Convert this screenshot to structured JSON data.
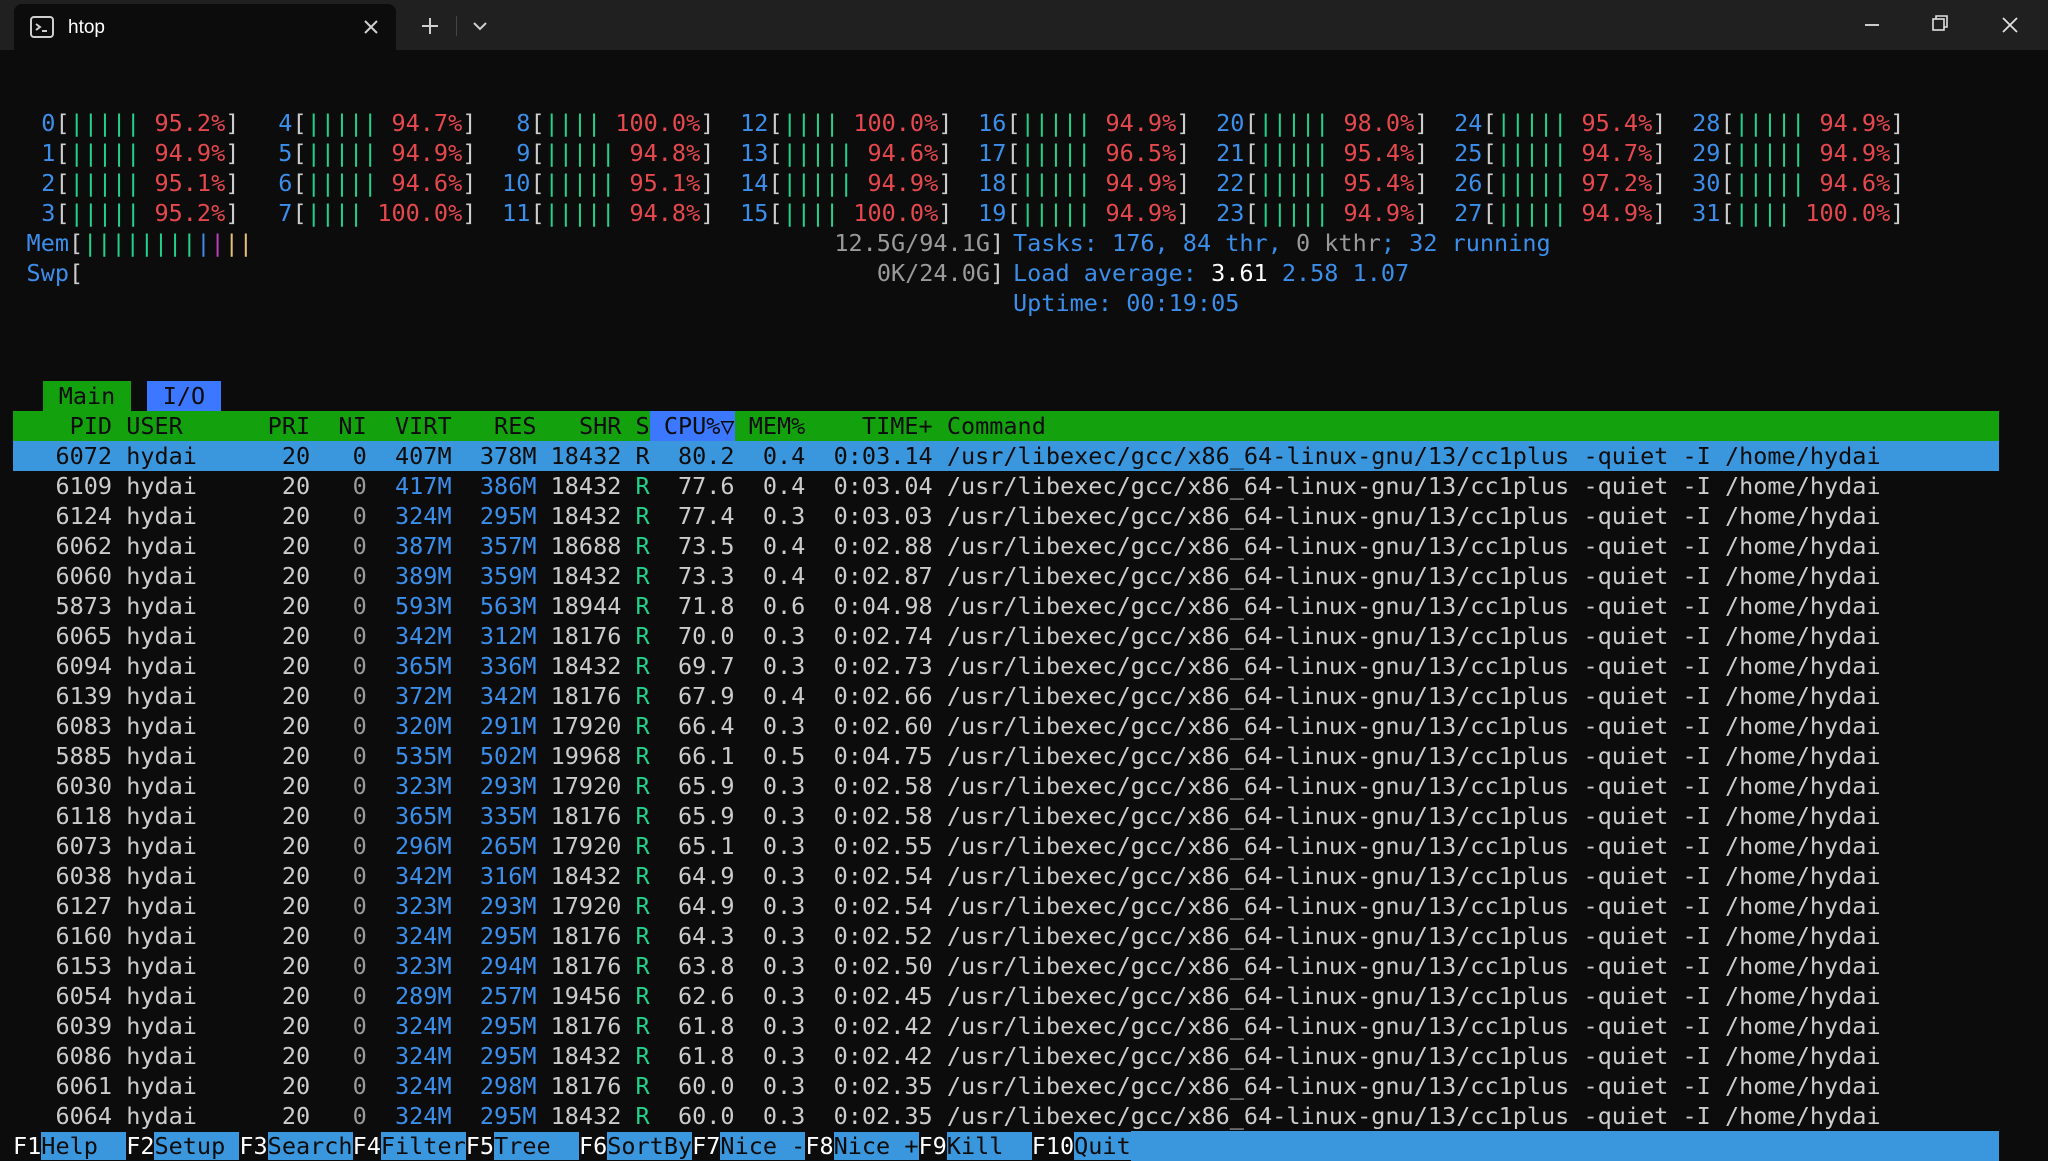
{
  "window": {
    "tab_title": "htop",
    "icons": {
      "tab": "terminal-icon",
      "close": "close-icon",
      "new_tab": "plus-icon",
      "dropdown": "chevron-down-icon",
      "minimize": "minimize-icon",
      "maximize": "maximize-icon",
      "window_close": "close-icon"
    }
  },
  "cpus": [
    {
      "id": "0",
      "bar": "|||||",
      "pct": "95.2%"
    },
    {
      "id": "1",
      "bar": "|||||",
      "pct": "94.9%"
    },
    {
      "id": "2",
      "bar": "|||||",
      "pct": "95.1%"
    },
    {
      "id": "3",
      "bar": "|||||",
      "pct": "95.2%"
    },
    {
      "id": "4",
      "bar": "|||||",
      "pct": "94.7%"
    },
    {
      "id": "5",
      "bar": "|||||",
      "pct": "94.9%"
    },
    {
      "id": "6",
      "bar": "|||||",
      "pct": "94.6%"
    },
    {
      "id": "7",
      "bar": "||||",
      "pct": "100.0%"
    },
    {
      "id": "8",
      "bar": "||||",
      "pct": "100.0%"
    },
    {
      "id": "9",
      "bar": "|||||",
      "pct": "94.8%"
    },
    {
      "id": "10",
      "bar": "|||||",
      "pct": "95.1%"
    },
    {
      "id": "11",
      "bar": "|||||",
      "pct": "94.8%"
    },
    {
      "id": "12",
      "bar": "||||",
      "pct": "100.0%"
    },
    {
      "id": "13",
      "bar": "|||||",
      "pct": "94.6%"
    },
    {
      "id": "14",
      "bar": "|||||",
      "pct": "94.9%"
    },
    {
      "id": "15",
      "bar": "||||",
      "pct": "100.0%"
    },
    {
      "id": "16",
      "bar": "|||||",
      "pct": "94.9%"
    },
    {
      "id": "17",
      "bar": "|||||",
      "pct": "96.5%"
    },
    {
      "id": "18",
      "bar": "|||||",
      "pct": "94.9%"
    },
    {
      "id": "19",
      "bar": "|||||",
      "pct": "94.9%"
    },
    {
      "id": "20",
      "bar": "|||||",
      "pct": "98.0%"
    },
    {
      "id": "21",
      "bar": "|||||",
      "pct": "95.4%"
    },
    {
      "id": "22",
      "bar": "|||||",
      "pct": "95.4%"
    },
    {
      "id": "23",
      "bar": "|||||",
      "pct": "94.9%"
    },
    {
      "id": "24",
      "bar": "|||||",
      "pct": "95.4%"
    },
    {
      "id": "25",
      "bar": "|||||",
      "pct": "94.7%"
    },
    {
      "id": "26",
      "bar": "|||||",
      "pct": "97.2%"
    },
    {
      "id": "27",
      "bar": "|||||",
      "pct": "94.9%"
    },
    {
      "id": "28",
      "bar": "|||||",
      "pct": "94.9%"
    },
    {
      "id": "29",
      "bar": "|||||",
      "pct": "94.9%"
    },
    {
      "id": "30",
      "bar": "|||||",
      "pct": "94.6%"
    },
    {
      "id": "31",
      "bar": "||||",
      "pct": "100.0%"
    }
  ],
  "mem": {
    "label": "Mem",
    "bar_green": "||||||||",
    "bar_blue": "|",
    "bar_magenta": "|",
    "bar_yellow": "||",
    "value": "12.5G/94.1G"
  },
  "swp": {
    "label": "Swp",
    "value": "0K/24.0G"
  },
  "tasks": {
    "label": "Tasks: ",
    "tasks": "176",
    "sep1": ", ",
    "thr": "84",
    "thr_label": " thr",
    "sep2": ", ",
    "kthr": "0 kthr",
    "sep3": "; ",
    "running": "32",
    "running_label": " running"
  },
  "load": {
    "label": "Load average: ",
    "v1": "3.61",
    "v2": "2.58",
    "v3": "1.07"
  },
  "uptime": {
    "label": "Uptime: ",
    "value": "00:19:05"
  },
  "tabs": [
    "Main",
    "I/O"
  ],
  "columns": {
    "pid": "PID",
    "user": "USER",
    "pri": "PRI",
    "ni": "NI",
    "virt": "VIRT",
    "res": "RES",
    "shr": "SHR",
    "s": "S",
    "cpu": "CPU%▽",
    "mem": "MEM%",
    "time": "TIME+",
    "command": "Command"
  },
  "processes": [
    {
      "pid": "6072",
      "user": "hydai",
      "pri": "20",
      "ni": "0",
      "virt": "407M",
      "res": "378M",
      "shr": "18432",
      "s": "R",
      "cpu": "80.2",
      "mem": "0.4",
      "time": "0:03.14",
      "command": "/usr/libexec/gcc/x86_64-linux-gnu/13/cc1plus -quiet -I /home/hydai"
    },
    {
      "pid": "6109",
      "user": "hydai",
      "pri": "20",
      "ni": "0",
      "virt": "417M",
      "res": "386M",
      "shr": "18432",
      "s": "R",
      "cpu": "77.6",
      "mem": "0.4",
      "time": "0:03.04",
      "command": "/usr/libexec/gcc/x86_64-linux-gnu/13/cc1plus -quiet -I /home/hydai"
    },
    {
      "pid": "6124",
      "user": "hydai",
      "pri": "20",
      "ni": "0",
      "virt": "324M",
      "res": "295M",
      "shr": "18432",
      "s": "R",
      "cpu": "77.4",
      "mem": "0.3",
      "time": "0:03.03",
      "command": "/usr/libexec/gcc/x86_64-linux-gnu/13/cc1plus -quiet -I /home/hydai"
    },
    {
      "pid": "6062",
      "user": "hydai",
      "pri": "20",
      "ni": "0",
      "virt": "387M",
      "res": "357M",
      "shr": "18688",
      "s": "R",
      "cpu": "73.5",
      "mem": "0.4",
      "time": "0:02.88",
      "command": "/usr/libexec/gcc/x86_64-linux-gnu/13/cc1plus -quiet -I /home/hydai"
    },
    {
      "pid": "6060",
      "user": "hydai",
      "pri": "20",
      "ni": "0",
      "virt": "389M",
      "res": "359M",
      "shr": "18432",
      "s": "R",
      "cpu": "73.3",
      "mem": "0.4",
      "time": "0:02.87",
      "command": "/usr/libexec/gcc/x86_64-linux-gnu/13/cc1plus -quiet -I /home/hydai"
    },
    {
      "pid": "5873",
      "user": "hydai",
      "pri": "20",
      "ni": "0",
      "virt": "593M",
      "res": "563M",
      "shr": "18944",
      "s": "R",
      "cpu": "71.8",
      "mem": "0.6",
      "time": "0:04.98",
      "command": "/usr/libexec/gcc/x86_64-linux-gnu/13/cc1plus -quiet -I /home/hydai"
    },
    {
      "pid": "6065",
      "user": "hydai",
      "pri": "20",
      "ni": "0",
      "virt": "342M",
      "res": "312M",
      "shr": "18176",
      "s": "R",
      "cpu": "70.0",
      "mem": "0.3",
      "time": "0:02.74",
      "command": "/usr/libexec/gcc/x86_64-linux-gnu/13/cc1plus -quiet -I /home/hydai"
    },
    {
      "pid": "6094",
      "user": "hydai",
      "pri": "20",
      "ni": "0",
      "virt": "365M",
      "res": "336M",
      "shr": "18432",
      "s": "R",
      "cpu": "69.7",
      "mem": "0.3",
      "time": "0:02.73",
      "command": "/usr/libexec/gcc/x86_64-linux-gnu/13/cc1plus -quiet -I /home/hydai"
    },
    {
      "pid": "6139",
      "user": "hydai",
      "pri": "20",
      "ni": "0",
      "virt": "372M",
      "res": "342M",
      "shr": "18176",
      "s": "R",
      "cpu": "67.9",
      "mem": "0.4",
      "time": "0:02.66",
      "command": "/usr/libexec/gcc/x86_64-linux-gnu/13/cc1plus -quiet -I /home/hydai"
    },
    {
      "pid": "6083",
      "user": "hydai",
      "pri": "20",
      "ni": "0",
      "virt": "320M",
      "res": "291M",
      "shr": "17920",
      "s": "R",
      "cpu": "66.4",
      "mem": "0.3",
      "time": "0:02.60",
      "command": "/usr/libexec/gcc/x86_64-linux-gnu/13/cc1plus -quiet -I /home/hydai"
    },
    {
      "pid": "5885",
      "user": "hydai",
      "pri": "20",
      "ni": "0",
      "virt": "535M",
      "res": "502M",
      "shr": "19968",
      "s": "R",
      "cpu": "66.1",
      "mem": "0.5",
      "time": "0:04.75",
      "command": "/usr/libexec/gcc/x86_64-linux-gnu/13/cc1plus -quiet -I /home/hydai"
    },
    {
      "pid": "6030",
      "user": "hydai",
      "pri": "20",
      "ni": "0",
      "virt": "323M",
      "res": "293M",
      "shr": "17920",
      "s": "R",
      "cpu": "65.9",
      "mem": "0.3",
      "time": "0:02.58",
      "command": "/usr/libexec/gcc/x86_64-linux-gnu/13/cc1plus -quiet -I /home/hydai"
    },
    {
      "pid": "6118",
      "user": "hydai",
      "pri": "20",
      "ni": "0",
      "virt": "365M",
      "res": "335M",
      "shr": "18176",
      "s": "R",
      "cpu": "65.9",
      "mem": "0.3",
      "time": "0:02.58",
      "command": "/usr/libexec/gcc/x86_64-linux-gnu/13/cc1plus -quiet -I /home/hydai"
    },
    {
      "pid": "6073",
      "user": "hydai",
      "pri": "20",
      "ni": "0",
      "virt": "296M",
      "res": "265M",
      "shr": "17920",
      "s": "R",
      "cpu": "65.1",
      "mem": "0.3",
      "time": "0:02.55",
      "command": "/usr/libexec/gcc/x86_64-linux-gnu/13/cc1plus -quiet -I /home/hydai"
    },
    {
      "pid": "6038",
      "user": "hydai",
      "pri": "20",
      "ni": "0",
      "virt": "342M",
      "res": "316M",
      "shr": "18432",
      "s": "R",
      "cpu": "64.9",
      "mem": "0.3",
      "time": "0:02.54",
      "command": "/usr/libexec/gcc/x86_64-linux-gnu/13/cc1plus -quiet -I /home/hydai"
    },
    {
      "pid": "6127",
      "user": "hydai",
      "pri": "20",
      "ni": "0",
      "virt": "323M",
      "res": "293M",
      "shr": "17920",
      "s": "R",
      "cpu": "64.9",
      "mem": "0.3",
      "time": "0:02.54",
      "command": "/usr/libexec/gcc/x86_64-linux-gnu/13/cc1plus -quiet -I /home/hydai"
    },
    {
      "pid": "6160",
      "user": "hydai",
      "pri": "20",
      "ni": "0",
      "virt": "324M",
      "res": "295M",
      "shr": "18176",
      "s": "R",
      "cpu": "64.3",
      "mem": "0.3",
      "time": "0:02.52",
      "command": "/usr/libexec/gcc/x86_64-linux-gnu/13/cc1plus -quiet -I /home/hydai"
    },
    {
      "pid": "6153",
      "user": "hydai",
      "pri": "20",
      "ni": "0",
      "virt": "323M",
      "res": "294M",
      "shr": "18176",
      "s": "R",
      "cpu": "63.8",
      "mem": "0.3",
      "time": "0:02.50",
      "command": "/usr/libexec/gcc/x86_64-linux-gnu/13/cc1plus -quiet -I /home/hydai"
    },
    {
      "pid": "6054",
      "user": "hydai",
      "pri": "20",
      "ni": "0",
      "virt": "289M",
      "res": "257M",
      "shr": "19456",
      "s": "R",
      "cpu": "62.6",
      "mem": "0.3",
      "time": "0:02.45",
      "command": "/usr/libexec/gcc/x86_64-linux-gnu/13/cc1plus -quiet -I /home/hydai"
    },
    {
      "pid": "6039",
      "user": "hydai",
      "pri": "20",
      "ni": "0",
      "virt": "324M",
      "res": "295M",
      "shr": "18176",
      "s": "R",
      "cpu": "61.8",
      "mem": "0.3",
      "time": "0:02.42",
      "command": "/usr/libexec/gcc/x86_64-linux-gnu/13/cc1plus -quiet -I /home/hydai"
    },
    {
      "pid": "6086",
      "user": "hydai",
      "pri": "20",
      "ni": "0",
      "virt": "324M",
      "res": "295M",
      "shr": "18432",
      "s": "R",
      "cpu": "61.8",
      "mem": "0.3",
      "time": "0:02.42",
      "command": "/usr/libexec/gcc/x86_64-linux-gnu/13/cc1plus -quiet -I /home/hydai"
    },
    {
      "pid": "6061",
      "user": "hydai",
      "pri": "20",
      "ni": "0",
      "virt": "324M",
      "res": "298M",
      "shr": "18176",
      "s": "R",
      "cpu": "60.0",
      "mem": "0.3",
      "time": "0:02.35",
      "command": "/usr/libexec/gcc/x86_64-linux-gnu/13/cc1plus -quiet -I /home/hydai"
    },
    {
      "pid": "6064",
      "user": "hydai",
      "pri": "20",
      "ni": "0",
      "virt": "324M",
      "res": "295M",
      "shr": "18432",
      "s": "R",
      "cpu": "60.0",
      "mem": "0.3",
      "time": "0:02.35",
      "command": "/usr/libexec/gcc/x86_64-linux-gnu/13/cc1plus -quiet -I /home/hydai"
    }
  ],
  "fkeys": [
    {
      "key": "F1",
      "label": "Help  "
    },
    {
      "key": "F2",
      "label": "Setup "
    },
    {
      "key": "F3",
      "label": "Search"
    },
    {
      "key": "F4",
      "label": "Filter"
    },
    {
      "key": "F5",
      "label": "Tree  "
    },
    {
      "key": "F6",
      "label": "SortBy"
    },
    {
      "key": "F7",
      "label": "Nice -"
    },
    {
      "key": "F8",
      "label": "Nice +"
    },
    {
      "key": "F9",
      "label": "Kill  "
    },
    {
      "key": "F10",
      "label": "Quit"
    }
  ],
  "colors": {
    "bg": "#0c0c0c",
    "green": "#13a10e",
    "blue": "#3a96dd",
    "cyan": "#3b8eea",
    "red": "#e5484d"
  }
}
